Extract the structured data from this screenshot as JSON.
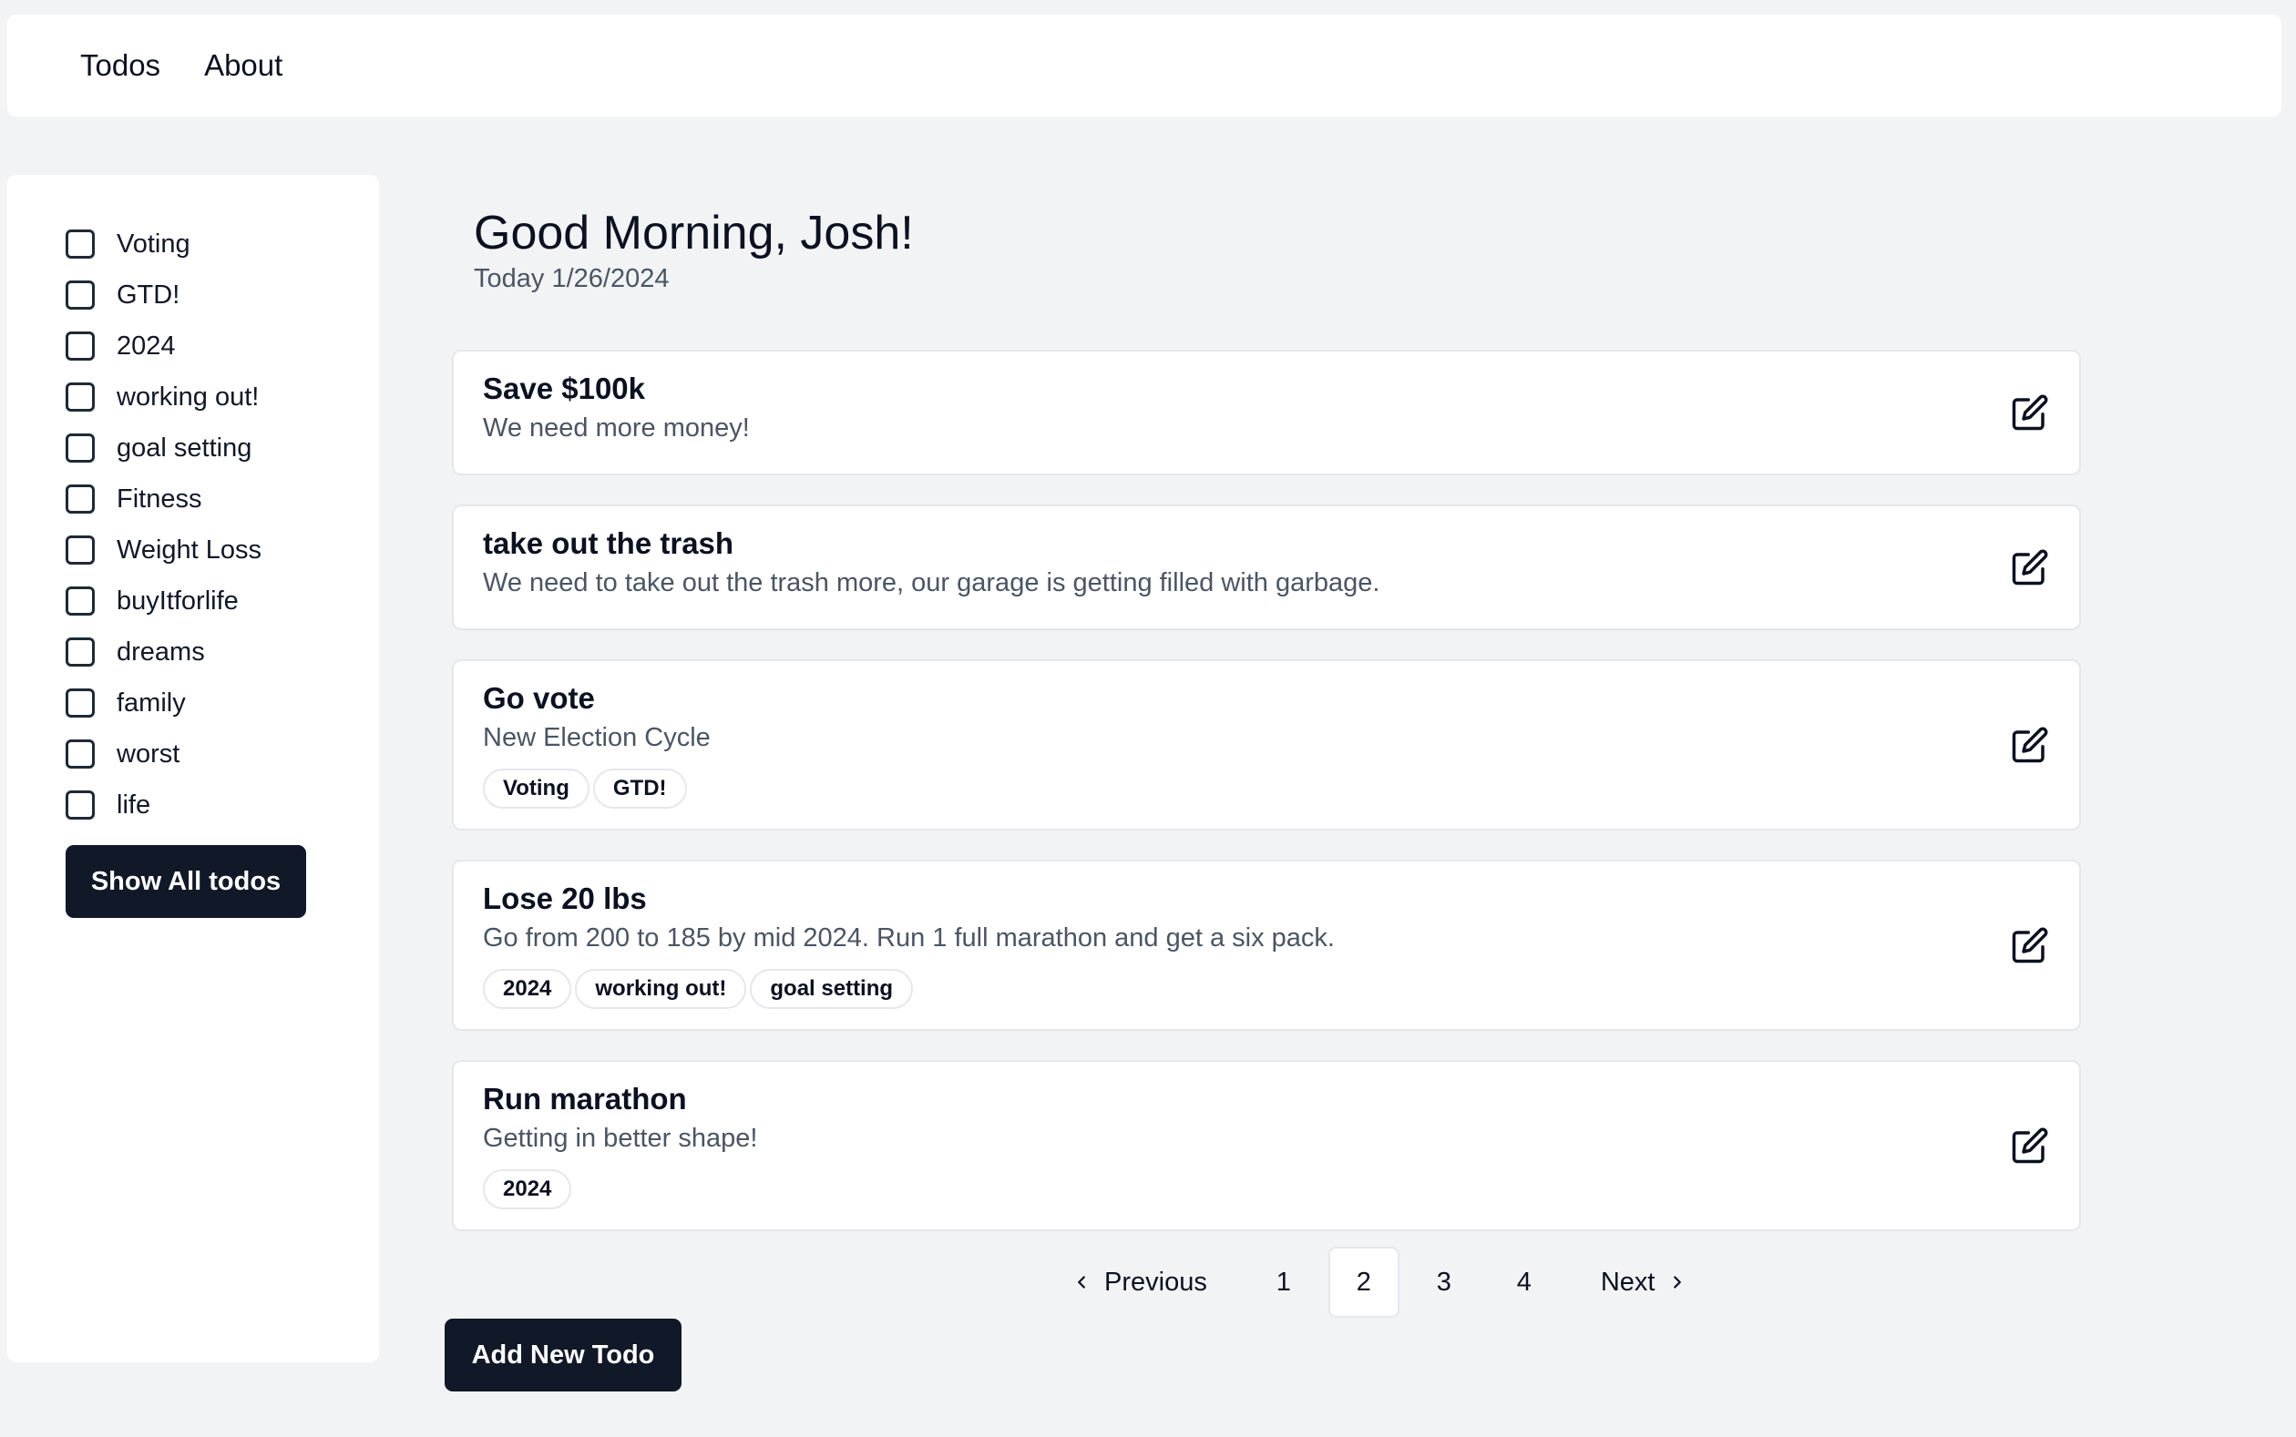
{
  "nav": {
    "links": [
      "Todos",
      "About"
    ]
  },
  "sidebar": {
    "tags": [
      "Voting",
      "GTD!",
      "2024",
      "working out!",
      "goal setting",
      "Fitness",
      "Weight Loss",
      "buyItforlife",
      "dreams",
      "family",
      "worst",
      "life"
    ],
    "show_all_label": "Show All todos"
  },
  "header": {
    "greeting": "Good Morning, Josh!",
    "date": "Today 1/26/2024"
  },
  "todos": [
    {
      "title": "Save $100k",
      "description": "We need more money!",
      "tags": []
    },
    {
      "title": "take out the trash",
      "description": "We need to take out the trash more, our garage is getting filled with garbage.",
      "tags": []
    },
    {
      "title": "Go vote",
      "description": "New Election Cycle",
      "tags": [
        "Voting",
        "GTD!"
      ]
    },
    {
      "title": "Lose 20 lbs",
      "description": "Go from 200 to 185 by mid 2024. Run 1 full marathon and get a six pack.",
      "tags": [
        "2024",
        "working out!",
        "goal setting"
      ]
    },
    {
      "title": "Run marathon",
      "description": "Getting in better shape!",
      "tags": [
        "2024"
      ]
    }
  ],
  "pagination": {
    "previous_label": "Previous",
    "next_label": "Next",
    "pages": [
      "1",
      "2",
      "3",
      "4"
    ],
    "current_page": "2"
  },
  "actions": {
    "add_todo_label": "Add New Todo"
  },
  "icons": {
    "edit": "edit-icon",
    "previous": "chevron-left-icon",
    "next": "chevron-right-icon"
  },
  "colors": {
    "background": "#f2f3f5",
    "surface": "#ffffff",
    "primary_button": "#111827",
    "muted_text": "#4b5563",
    "border": "#e5e7eb"
  }
}
